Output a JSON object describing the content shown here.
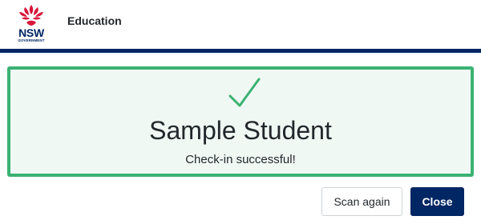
{
  "header": {
    "logo": {
      "brand_text": "NSW",
      "sub_text": "GOVERNMENT",
      "icon": "waratah-icon",
      "color": "#d7153a"
    },
    "title": "Education",
    "accent_color": "#002664"
  },
  "result": {
    "icon": "checkmark-icon",
    "student_name": "Sample Student",
    "message": "Check-in successful!",
    "border_color": "#3bb273",
    "background_color": "#f0f8f4"
  },
  "actions": {
    "scan_again_label": "Scan again",
    "close_label": "Close"
  }
}
